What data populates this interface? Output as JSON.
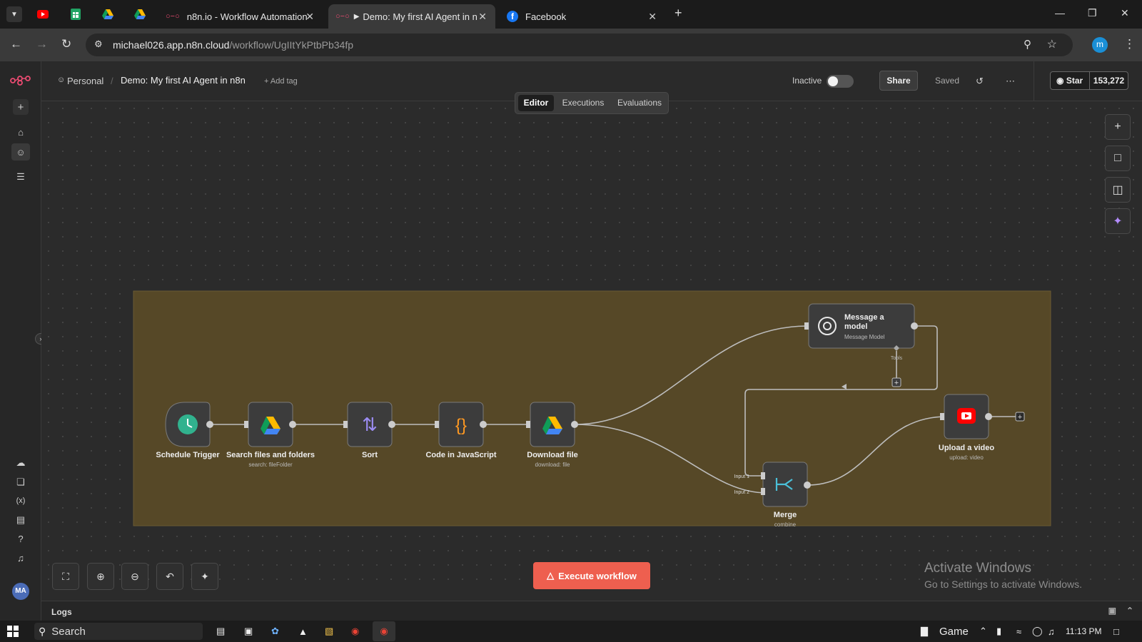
{
  "browser": {
    "tabs": [
      {
        "title": "n8n.io - Workflow Automation"
      },
      {
        "title": "Demo: My first AI Agent in n"
      },
      {
        "title": "Facebook"
      }
    ],
    "url_host": "michael026.app.n8n.cloud",
    "url_path": "/workflow/UgIItYkPtbPb34fp",
    "profile_initial": "m"
  },
  "header": {
    "breadcrumb_personal": "Personal",
    "workflow_title": "Demo: My first AI Agent in n8n",
    "add_tag": "+ Add tag",
    "status_label": "Inactive",
    "share": "Share",
    "saved": "Saved",
    "github_star": "Star",
    "github_count": "153,272"
  },
  "view_tabs": [
    "Editor",
    "Executions",
    "Evaluations"
  ],
  "nodes": {
    "schedule": {
      "title": "Schedule Trigger"
    },
    "search": {
      "title": "Search files and folders",
      "subtitle": "search: fileFolder"
    },
    "sort": {
      "title": "Sort"
    },
    "code": {
      "title": "Code in JavaScript"
    },
    "download": {
      "title": "Download file",
      "subtitle": "download: file"
    },
    "message_model": {
      "title_line1": "Message a",
      "title_line2": "model",
      "subtitle": "Message Model",
      "tools_label": "Tools"
    },
    "merge": {
      "title": "Merge",
      "subtitle": "combine",
      "input1": "Input 1",
      "input2": "Input 2"
    },
    "upload": {
      "title": "Upload a video",
      "subtitle": "upload: video"
    }
  },
  "execute_button": "Execute workflow",
  "activate_windows": {
    "line1": "Activate Windows",
    "line2": "Go to Settings to activate Windows."
  },
  "logs_label": "Logs",
  "user_initials": "MA",
  "taskbar": {
    "search": "Search",
    "game": "Game",
    "time": "11:13 PM"
  },
  "colors": {
    "sticky": "#564827",
    "execute": "#ee5f4f",
    "accent": "#ff6d5a"
  }
}
